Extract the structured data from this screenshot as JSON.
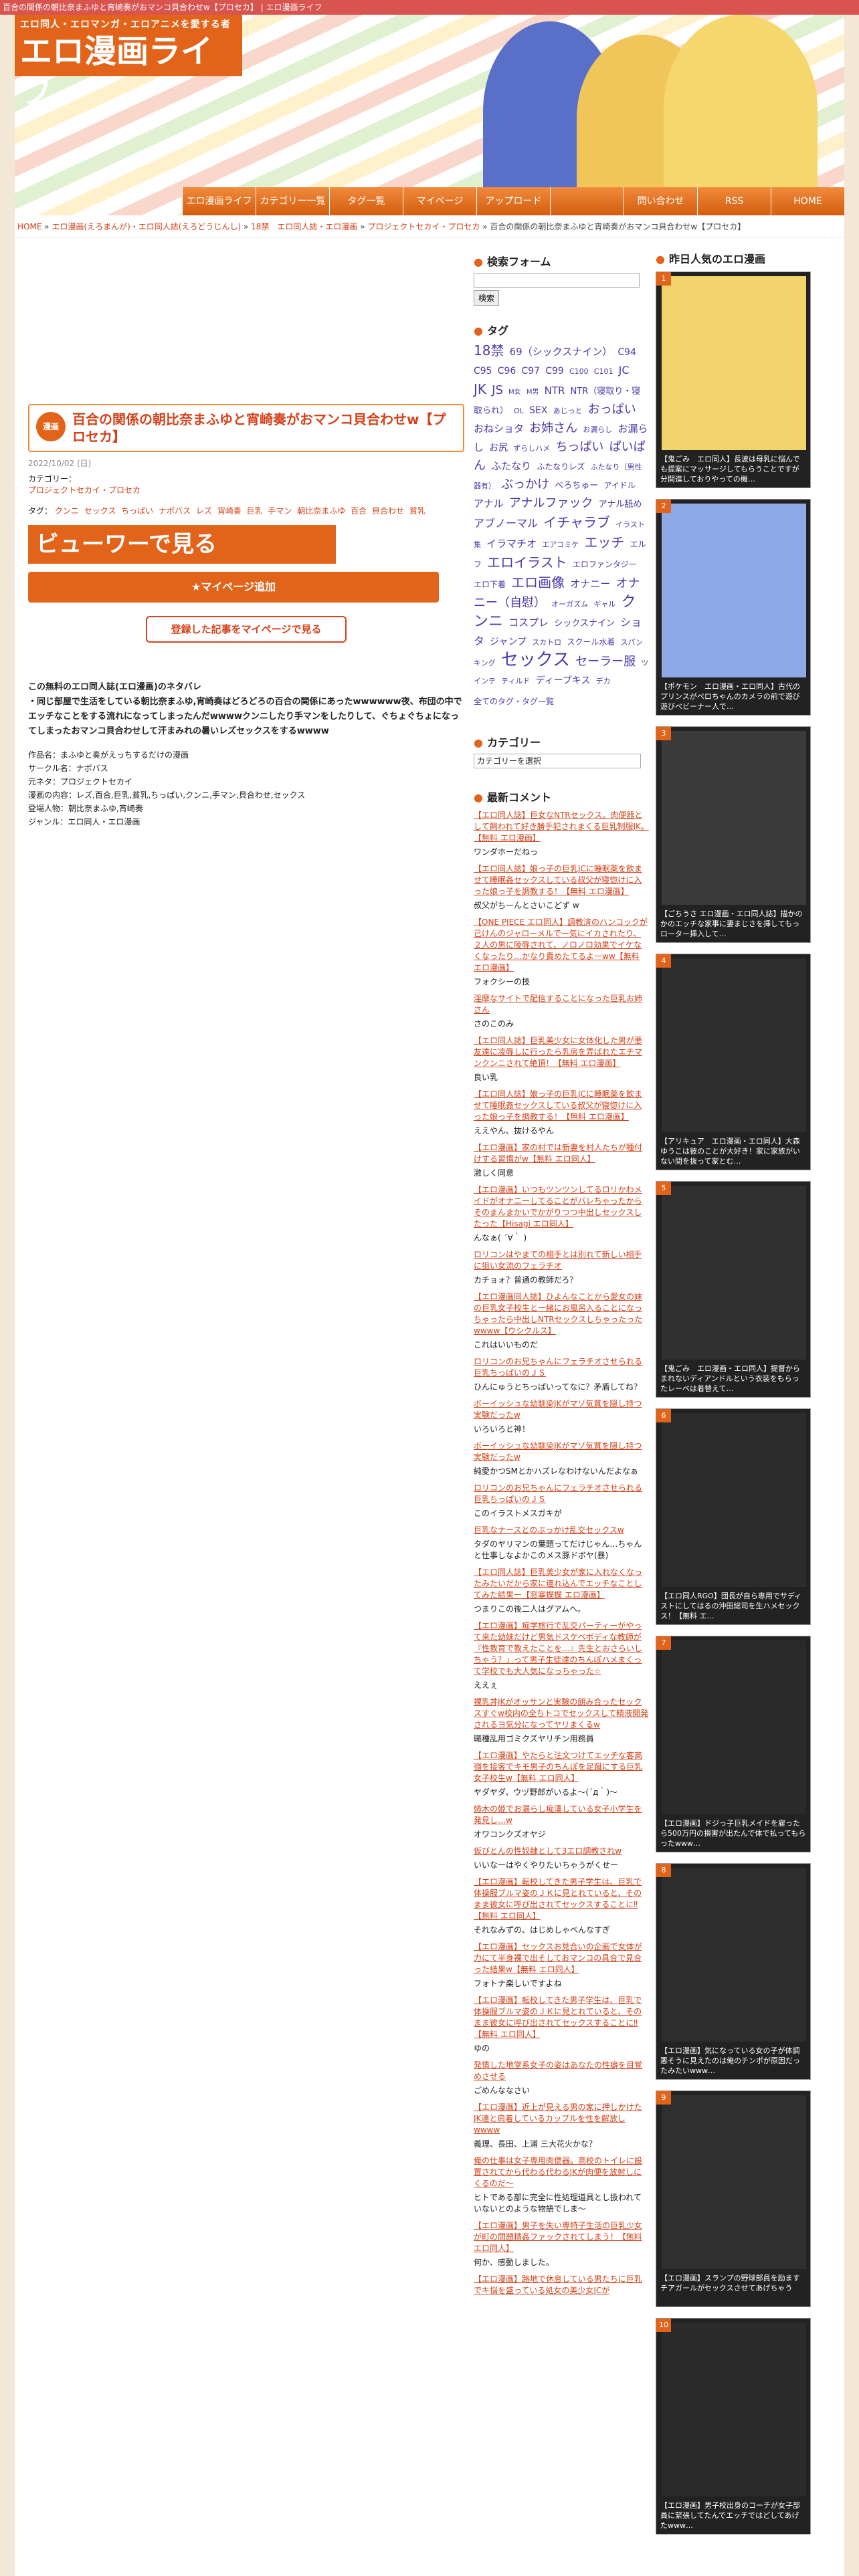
{
  "topbar": "百合の関係の朝比奈まふゆと宵崎奏がおマンコ貝合わせw【プロセカ】 | エロ漫画ライフ",
  "logo": {
    "tagline": "エロ同人・エロマンガ・エロアニメを愛する者",
    "name": "エロ漫画ライフ"
  },
  "nav": [
    "エロ漫画ライフ",
    "カテゴリー一覧",
    "タグ一覧",
    "マイページ",
    "アップロード",
    "",
    "問い合わせ",
    "RSS",
    "HOME"
  ],
  "breadcrumb": {
    "home": "HOME",
    "c1": "エロ漫画(えろまんが)・エロ同人誌(えろどうじんし)",
    "c2": "18禁　エロ同人誌・エロ漫画",
    "c3": "プロジェクトセカイ・プロセカ",
    "current": "百合の関係の朝比奈まふゆと宵崎奏がおマンコ貝合わせw【プロセカ】"
  },
  "post": {
    "badge": "漫画",
    "title": "百合の関係の朝比奈まふゆと宵崎奏がおマンコ貝合わせw【プロセカ】",
    "date": "2022/10/02 (日)",
    "category_label": "カテゴリー：",
    "category": "プロジェクトセカイ・プロセカ",
    "tags_label": "タグ：",
    "tags": [
      "クンニ",
      "セックス",
      "ちっぱい",
      "ナポバス",
      "レズ",
      "宵崎奏",
      "巨乳",
      "手マン",
      "朝比奈まふゆ",
      "百合",
      "貝合わせ",
      "貧乳"
    ],
    "viewer": "ビューワーで見る",
    "mypage_add": "★マイページ追加",
    "register": "登録した記事をマイページで見る",
    "desc1": "この無料のエロ同人誌(エロ漫画)のネタバレ",
    "desc2": "・同じ部屋で生活をしている朝比奈まふゆ,宵崎奏はどろどろの百合の関係にあったwwwwww夜、布団の中でエッチなことをする流れになってしまったんだwwwwクンニしたり手マンをしたりして、ぐちょぐちょになってしまったおマンコ貝合わせして汗まみれの暑いレズセックスをするwwww",
    "info": [
      "作品名：まふゆと奏がえっちするだけの漫画",
      "サークル名：ナポバス",
      "元ネタ：プロジェクトセカイ",
      "漫画の内容：レズ,百合,巨乳,貧乳,ちっぱい,クンニ,手マン,貝合わせ,セックス",
      "登場人物：朝比奈まふゆ,宵崎奏",
      "ジャンル：エロ同人・エロ漫画"
    ]
  },
  "sidebar": {
    "search_title": "検索フォーム",
    "search_button": "検索",
    "tag_title": "タグ",
    "tags": [
      {
        "t": "18禁",
        "s": 20
      },
      {
        "t": "69（シックスナイン）",
        "s": 15
      },
      {
        "t": "C94",
        "s": 14
      },
      {
        "t": "C95",
        "s": 14
      },
      {
        "t": "C96",
        "s": 14
      },
      {
        "t": "C97",
        "s": 14
      },
      {
        "t": "C99",
        "s": 14
      },
      {
        "t": "C100",
        "s": 11
      },
      {
        "t": "C101",
        "s": 11
      },
      {
        "t": "JC",
        "s": 16
      },
      {
        "t": "JK",
        "s": 20
      },
      {
        "t": "JS",
        "s": 18
      },
      {
        "t": "M女",
        "s": 10
      },
      {
        "t": "M男",
        "s": 10
      },
      {
        "t": "NTR",
        "s": 15
      },
      {
        "t": "NTR（寝取り・寝取られ）",
        "s": 13
      },
      {
        "t": "OL",
        "s": 11
      },
      {
        "t": "SEX",
        "s": 14
      },
      {
        "t": "あじっと",
        "s": 11
      },
      {
        "t": "おっぱい",
        "s": 18
      },
      {
        "t": "おねショタ",
        "s": 15
      },
      {
        "t": "お姉さん",
        "s": 18
      },
      {
        "t": "お漏らし",
        "s": 11
      },
      {
        "t": "お漏らし",
        "s": 15
      },
      {
        "t": "お尻",
        "s": 14
      },
      {
        "t": "ずらしハメ",
        "s": 11
      },
      {
        "t": "ちっぱい",
        "s": 18
      },
      {
        "t": "ぱいぱん",
        "s": 18
      },
      {
        "t": "ふたなり",
        "s": 15
      },
      {
        "t": "ふたなりレズ",
        "s": 12
      },
      {
        "t": "ふたなり（男性器有）",
        "s": 11
      },
      {
        "t": "ぶっかけ",
        "s": 18
      },
      {
        "t": "べろちゅー",
        "s": 13
      },
      {
        "t": "アイドル",
        "s": 12
      },
      {
        "t": "アナル",
        "s": 15
      },
      {
        "t": "アナルファック",
        "s": 18
      },
      {
        "t": "アナル舐め",
        "s": 13
      },
      {
        "t": "アブノーマル",
        "s": 16
      },
      {
        "t": "イチャラブ",
        "s": 20
      },
      {
        "t": "イラスト集",
        "s": 11
      },
      {
        "t": "イラマチオ",
        "s": 15
      },
      {
        "t": "エアコミケ",
        "s": 11
      },
      {
        "t": "エッチ",
        "s": 20
      },
      {
        "t": "エルフ",
        "s": 12
      },
      {
        "t": "エロイラスト",
        "s": 20
      },
      {
        "t": "エロファンタジー",
        "s": 12
      },
      {
        "t": "エロ下着",
        "s": 12
      },
      {
        "t": "エロ画像",
        "s": 20
      },
      {
        "t": "オナニー",
        "s": 15
      },
      {
        "t": "オナニー（自慰）",
        "s": 18
      },
      {
        "t": "オーガズム",
        "s": 11
      },
      {
        "t": "ギャル",
        "s": 11
      },
      {
        "t": "クンニ",
        "s": 22
      },
      {
        "t": "コスプレ",
        "s": 15
      },
      {
        "t": "シックスナイン",
        "s": 13
      },
      {
        "t": "ショタ",
        "s": 16
      },
      {
        "t": "ジャンプ",
        "s": 14
      },
      {
        "t": "スカトロ",
        "s": 11
      },
      {
        "t": "スクール水着",
        "s": 12
      },
      {
        "t": "スパンキング",
        "s": 11
      },
      {
        "t": "セックス",
        "s": 26
      },
      {
        "t": "セーラー服",
        "s": 18
      },
      {
        "t": "ツインテ",
        "s": 11
      },
      {
        "t": "ティルド",
        "s": 11
      },
      {
        "t": "ディープキス",
        "s": 14
      },
      {
        "t": "デカ",
        "s": 11
      }
    ],
    "tag_all": "全てのタグ・タグ一覧",
    "category_title": "カテゴリー",
    "category_select": "カテゴリーを選択",
    "comments_title": "最新コメント",
    "comments": [
      {
        "link": "【エロ同人誌】巨女なNTRセックス。肉便器として飼われて好き勝手犯されまくる巨乳制服JK。【無料 エロ漫画】",
        "text": "ワンダホーだねっ"
      },
      {
        "link": "【エロ同人誌】娘っ子の巨乳JCに睡眠薬を飲ませて睡眠姦セックスしている叔父が寝惚けに入った娘っ子を調教する！【無料 エロ漫画】",
        "text": "叔父がちーんとさいこどず w"
      },
      {
        "link": "【ONE PIECE エロ同人】調教済のハンコックが己けんのジャローメルで一気にイカされたり、２人の男に陵辱されて、ノロノロ効果でイケなくなったり…かなり責めたてるよーww【無料 エロ漫画】",
        "text": "フォクシーの技"
      },
      {
        "link": "淫靡なサイトで配信することになった巨乳お姉さん",
        "text": "さのこのみ"
      },
      {
        "link": "【エロ同人誌】巨乳美少女に女体化した男が悪友達に凌辱しに行ったら乳房を弄ばれたエチマンクンニされて絶頂！【無料 エロ漫画】",
        "text": "良い乳"
      },
      {
        "link": "【エロ同人誌】娘っ子の巨乳JCに睡眠薬を飲ませて睡眠姦セックスしている叔父が寝惚けに入った娘っ子を調教する！【無料 エロ漫画】",
        "text": "ええやん、抜けるやん"
      },
      {
        "link": "【エロ漫画】家の村では新妻を村人たちが種付けする習慣がw【無料 エロ同人】",
        "text": "激しく同意"
      },
      {
        "link": "【エロ漫画】いつもツンツンしてるロリかわメイドがオナニーしてることがバレちゃったからそのまんまかいでかがりつつ中出しセックスしたった【Hisagi エロ同人】",
        "text": "んなぁ( ´∀｀ )"
      },
      {
        "link": "ロリコンはやまての相手とは別れて新しい相手に狙い女流のフェラチオ",
        "text": "カチョォ？普通の教師だろ？"
      },
      {
        "link": "【エロ漫画同人誌】ひよんなことから愛女の妹の巨乳女子校生と一緒にお風呂入ることになっちゃったら中出しNTRセックスしちゃったったwwww【ウシクルス】",
        "text": "これはいいものだ"
      },
      {
        "link": "ロリコンのお兄ちゃんにフェラチオさせられる巨乳ちっぱいのＪＳ",
        "text": "ひんにゅうとちっぱいってなに？矛盾してね？"
      },
      {
        "link": "ボーイッシュな幼馴染JKがマゾ気質を隠し持つ実験だったw",
        "text": "いろいろと神！"
      },
      {
        "link": "ボーイッシュな幼馴染JKがマゾ気質を隠し持つ実験だったw",
        "text": "純愛かつSMとかハズレなわけないんだよなぁ"
      },
      {
        "link": "ロリコンのお兄ちゃんにフェラチオさせられる巨乳ちっぱいのＪＳ",
        "text": "このイラストメスガキが"
      },
      {
        "link": "巨乳なナースとのぶっかけ乱交セックスw",
        "text": "タダのヤリマンの葉題ってだけじゃん…ちゃんと仕事しなよかこのメス豚ドボヤ(暴)"
      },
      {
        "link": "【エロ同人誌】巨乳美少女が家に入れなくなったみたいだから家に連れ込んでエッチなことしてみた結果ー【窓塞蝶蝶 エロ漫画】",
        "text": "つまりこの後二人はグアムへ。"
      },
      {
        "link": "【エロ漫画】痴学旅行で乱交パーティーがやって来た幼妹だけど男気ドスケベボディな教師が『性教育で教えたことを…』先生とおさらいしちゃう？」って男子生徒達のちんぽハメまくって学校でも大人気になっちゃった☆",
        "text": "ええぇ"
      },
      {
        "link": "裸乳丼JKがオッサンと実験の朗み合ったセックスすぐw校内の全ちトコでセックスして精液開発されるヨ気分になってヤリまくるw",
        "text": "職種乱用ゴミクズヤリチン用務員"
      },
      {
        "link": "【エロ漫画】やたらと注文つけてエッチな客高嶺を接客でキモ男子のちんぽを足蹴にする巨乳女子校生w【無料 エロ同人】",
        "text": "ヤダヤダ、ウヅ野郎がいるよ～(´д｀)～"
      },
      {
        "link": "姉木の姫でお漏らし痴漢している女子小学生を発見し…w",
        "text": "オワコンクズオヤジ"
      },
      {
        "link": "仮びとんの性奴隷として3エロ調教されw",
        "text": "いいなーはやくやりたいちゃうがくせー"
      },
      {
        "link": "【エロ漫画】転校してきた男子学生は、巨乳で体操服ブルマ姿のＪＫに見とれていると、そのまま彼女に呼び出されてセックスすることに‼【無料 エロ同人】",
        "text": "それなみずの、はじめしゃべんなすぎ"
      },
      {
        "link": "【エロ漫画】セックスお見合いの企画で女体が力にて半身裸で出そしておマンコの具合で見合った結果w【無料 エロ同人】",
        "text": "フォトナ楽しいですよね"
      },
      {
        "link": "【エロ漫画】転校してきた男子学生は、巨乳で体操服ブルマ姿のＪＫに見とれていると、そのまま彼女に呼び出されてセックスすることに‼【無料 エロ同人】",
        "text": "ゆの"
      },
      {
        "link": "発情した地堂系女子の姿はあなたの性癖を目覚めさせる",
        "text": "ごめんななさい"
      },
      {
        "link": "【エロ漫画】近上が見える男の家に押しかけたJK達と肩着しているカップルを性を解放しwwww",
        "text": "義理、長田、上浦 三大花火かな？"
      },
      {
        "link": "俺の仕事は女子専用肉便器。高校のトイレに設置されてから代わる代わるJKが肉便を放射しにくるのだ～",
        "text": "ヒトである部に完全に性処理道具とし扱われていないとのような物語でしま～"
      },
      {
        "link": "【エロ漫画】男子を失い専特子生活の巨乳少女が町の問題精姦ファックされてしまう！【無料 エロ同人】",
        "text": "何か、感動しました。"
      },
      {
        "link": "【エロ漫画】路地で休息している男たちに巨乳でキ悩を盛っている処女の美少女JCが"
      }
    ]
  },
  "ranking": {
    "title": "昨日人気のエロ漫画",
    "items": [
      {
        "num": "1",
        "cap": "【鬼ごみ　エロ同人】長波は母乳に悩んでも提案にマッサージしてもらうことですが分開進しておりやっての機…"
      },
      {
        "num": "2",
        "cap": "【ポケモン　エロ漫画・エロ同人】古代のプリンスがペロちゃんのカメラの前で遊び遊びべビーナー人で…"
      },
      {
        "num": "3",
        "cap": "【ごちうさ エロ漫画・エロ同人誌】描かのかのエッチな家事に妻まじさを挿してもっローター挿入して…"
      },
      {
        "num": "4",
        "cap": "【アリキュア　エロ漫画・エロ同人】大森ゆうこは彼のことが大好き！家に家族がいない間を抜って家とむ…"
      },
      {
        "num": "5",
        "cap": "【鬼ごみ　エロ漫画・エロ同人】提督からまれないディアンドルという衣装をもらったレーベは着替えて…"
      },
      {
        "num": "6",
        "cap": "【エロ同人RGO】団長が自ら専用でサディストにしてはるの沖田総司を生ハメセックス！【無料 エ…"
      },
      {
        "num": "7",
        "cap": "【エロ漫画】ドジっ子巨乳メイドを雇ったら500万円の損害が出たんで体で払ってもらったwww…"
      },
      {
        "num": "8",
        "cap": "【エロ漫画】気になっている女の子が体調悪そうに見えたのは俺のチンポが原因だったみたいwww…"
      },
      {
        "num": "9",
        "cap": "【エロ漫画】スランプの野球部員を励ますチアガールがセックスさせてあげちゃう"
      },
      {
        "num": "10",
        "cap": "【エロ漫画】男子校出身のコーチが女子部員に緊張してたんでエッチではどしてあげたwww…"
      }
    ]
  },
  "colors": {
    "accent": "#e2631a",
    "topbar": "#d9534f",
    "link": "#d3421a",
    "tag": "#4a3ca8"
  }
}
